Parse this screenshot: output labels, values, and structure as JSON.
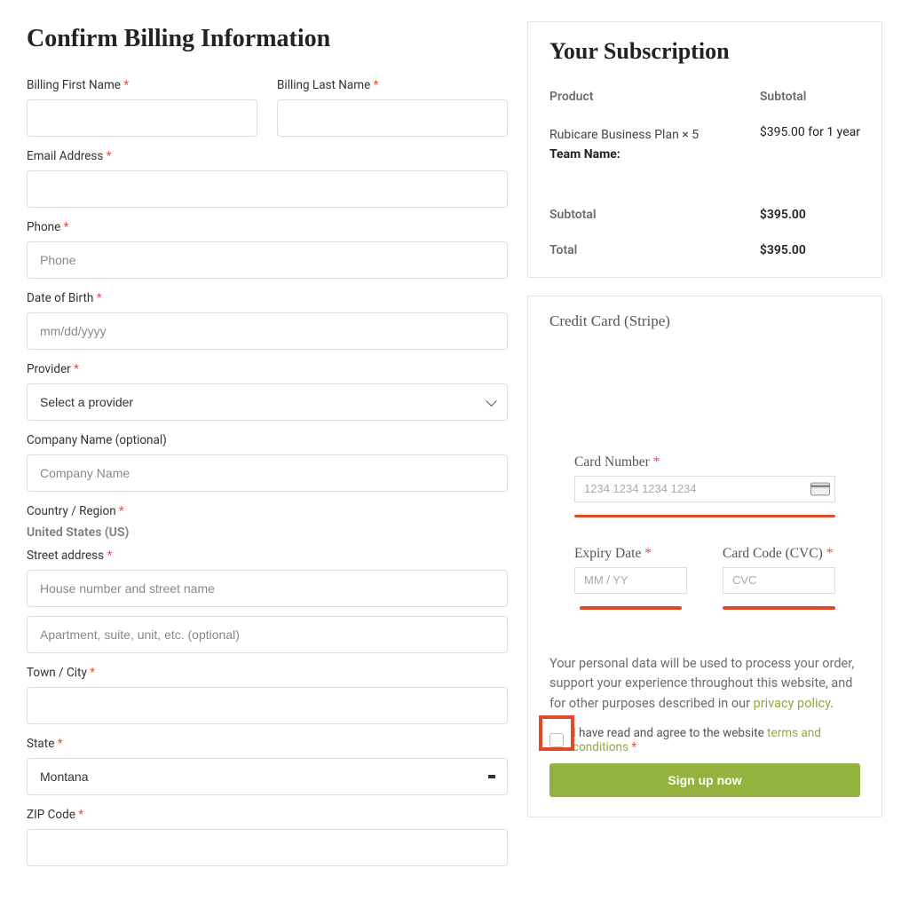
{
  "billing": {
    "title": "Confirm Billing Information",
    "fields": {
      "first_name": {
        "label": "Billing First Name"
      },
      "last_name": {
        "label": "Billing Last Name"
      },
      "email": {
        "label": "Email Address"
      },
      "phone": {
        "label": "Phone",
        "placeholder": "Phone"
      },
      "dob": {
        "label": "Date of Birth",
        "placeholder": "mm/dd/yyyy"
      },
      "provider": {
        "label": "Provider",
        "placeholder": "Select a provider"
      },
      "company": {
        "label": "Company Name (optional)",
        "placeholder": "Company Name"
      },
      "country": {
        "label": "Country / Region",
        "value": "United States (US)"
      },
      "street": {
        "label": "Street address",
        "placeholder1": "House number and street name",
        "placeholder2": "Apartment, suite, unit, etc. (optional)"
      },
      "city": {
        "label": "Town / City"
      },
      "state": {
        "label": "State",
        "value": "Montana"
      },
      "zip": {
        "label": "ZIP Code"
      }
    }
  },
  "subscription": {
    "title": "Your Subscription",
    "headers": {
      "product": "Product",
      "subtotal": "Subtotal"
    },
    "item": {
      "name": "Rubicare Business Plan  × 5",
      "team_label": "Team Name:",
      "price": "$395.00 for 1 year"
    },
    "subtotal": {
      "label": "Subtotal",
      "value": "$395.00"
    },
    "total": {
      "label": "Total",
      "value": "$395.00"
    }
  },
  "payment": {
    "method_title": "Credit Card (Stripe)",
    "card_number": {
      "label": "Card Number",
      "placeholder": "1234 1234 1234 1234"
    },
    "expiry": {
      "label": "Expiry Date",
      "placeholder": "MM / YY"
    },
    "cvc": {
      "label": "Card Code (CVC)",
      "placeholder": "CVC"
    },
    "privacy_text": "Your personal data will be used to process your order, support your experience throughout this website, and for other purposes described in our ",
    "privacy_link": "privacy policy",
    "agree_prefix": "I have read and agree to the website ",
    "terms_link": "terms and conditions",
    "button": "Sign up now"
  },
  "required_mark": "*"
}
